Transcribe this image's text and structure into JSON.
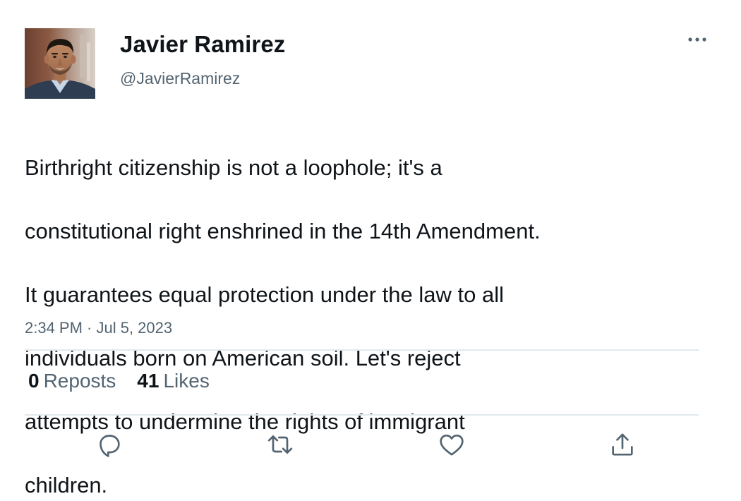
{
  "author": {
    "display_name": "Javier Ramirez",
    "handle": "@JavierRamirez",
    "avatar_icon": "profile-photo"
  },
  "tweet": {
    "text_lines": [
      "Birthright citizenship is not a loophole; it's a",
      "constitutional right enshrined in the 14th Amendment.",
      "It guarantees equal protection under the law to all",
      "individuals born on American soil. Let's reject",
      "attempts to undermine the rights of immigrant",
      "children."
    ],
    "timestamp": "2:34 PM · Jul 5, 2023"
  },
  "stats": {
    "reposts_count": "0",
    "reposts_label": "Reposts",
    "likes_count": "41",
    "likes_label": "Likes"
  },
  "actions": {
    "reply_icon": "reply-icon",
    "repost_icon": "repost-icon",
    "like_icon": "heart-icon",
    "share_icon": "share-icon",
    "more_icon": "more-icon"
  },
  "colors": {
    "text_primary": "#0f1419",
    "text_secondary": "#536471",
    "icon": "#536471",
    "divider": "#e1e8ed"
  }
}
